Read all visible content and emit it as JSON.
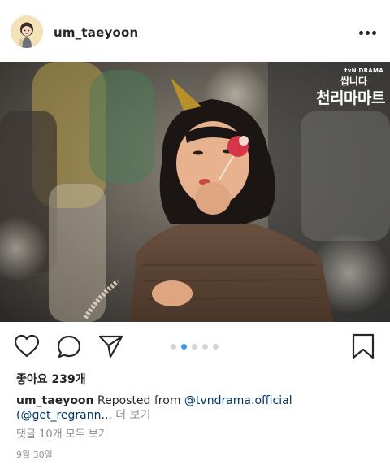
{
  "header": {
    "username": "um_taeyoon",
    "avatar_icon": "profile-avatar",
    "more_icon": "more-options-icon"
  },
  "post_image": {
    "badge_network": "tvN DRAMA",
    "badge_line1": "쌉니다",
    "badge_line2": "천리마마트"
  },
  "actions": {
    "like_icon": "heart-icon",
    "comment_icon": "comment-icon",
    "share_icon": "send-icon",
    "save_icon": "bookmark-icon",
    "carousel_count": 5,
    "carousel_active_index": 1
  },
  "post": {
    "likes": "좋아요 239개",
    "caption_user": "um_taeyoon",
    "caption_text": " Reposted from ",
    "caption_mention1": "@tvndrama.official",
    "caption_mention2": "(@get_regrann",
    "caption_ellipsis": "...",
    "more_label": "더 보기",
    "view_comments": "댓글 10개 모두 보기",
    "date": "9월 30일"
  },
  "colors": {
    "link": "#003569",
    "muted": "#8e8e8e",
    "active_dot": "#3897f0",
    "inactive_dot": "#d5d5d5"
  }
}
